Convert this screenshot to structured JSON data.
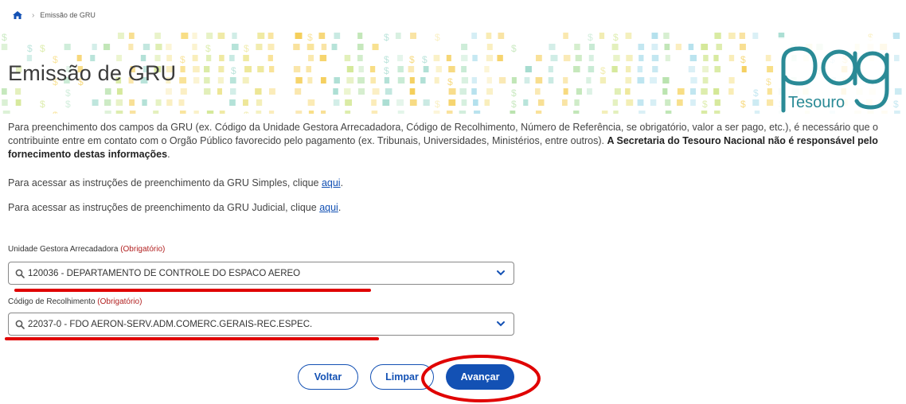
{
  "breadcrumb": {
    "current": "Emissão de GRU"
  },
  "header": {
    "title": "Emissão de GRU",
    "logo_text": "Tesouro"
  },
  "intro": {
    "text": "Para preenchimento dos campos da GRU (ex. Código da Unidade Gestora Arrecadadora, Código de Recolhimento, Número de Referência, se obrigatório, valor a ser pago, etc.), é necessário que o contribuinte entre em contato com o Orgão Público favorecido pelo pagamento (ex. Tribunais, Universidades, Ministérios, entre outros).",
    "bold": "A Secretaria do Tesouro Nacional não é responsável pelo fornecimento destas informações",
    "end": "."
  },
  "links": {
    "simples_text": "Para acessar as instruções de preenchimento da GRU Simples, clique",
    "simples_link": "aqui",
    "judicial_text": "Para acessar as instruções de preenchimento da GRU Judicial, clique",
    "judicial_link": "aqui"
  },
  "form": {
    "ug_label": "Unidade Gestora Arrecadadora",
    "ug_required": "(Obrigatório)",
    "ug_value": "120036 - DEPARTAMENTO DE CONTROLE DO ESPACO AEREO",
    "codigo_label": "Código de Recolhimento",
    "codigo_required": "(Obrigatório)",
    "codigo_value": "22037-0 - FDO AERON-SERV.ADM.COMERC.GERAIS-REC.ESPEC."
  },
  "buttons": {
    "voltar": "Voltar",
    "limpar": "Limpar",
    "avancar": "Avançar"
  },
  "colors": {
    "primary": "#1351b4",
    "annotation": "#e00000",
    "required": "#b22222",
    "logo": "#2a8a96"
  }
}
